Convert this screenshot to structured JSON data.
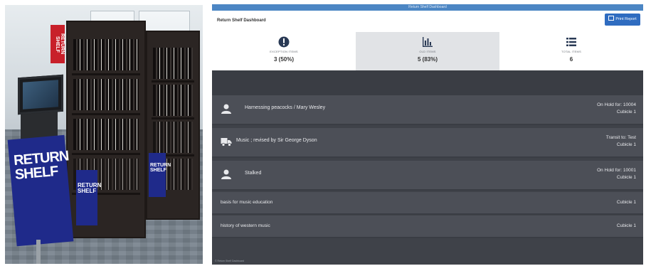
{
  "photo": {
    "sign_large_lines": [
      "RETURN",
      "SHELF"
    ],
    "sign_small_lines": [
      "RETURN",
      "SHELF"
    ],
    "sign_right_lines": [
      "RETURN",
      "SHELF"
    ],
    "sign_top": "RETURN SHELF"
  },
  "app": {
    "window_title": "Return Shelf Dashboard",
    "header_title": "Return Shelf Dashboard",
    "print_button": "Print Report",
    "stats": [
      {
        "label": "EXCEPTION ITEMS",
        "value": "3 (50%)",
        "icon": "exclamation-circle-icon",
        "active": false
      },
      {
        "label": "OLD ITEMS",
        "value": "5 (83%)",
        "icon": "bar-chart-icon",
        "active": true
      },
      {
        "label": "TOTAL ITEMS",
        "value": "6",
        "icon": "list-icon",
        "active": false
      }
    ],
    "rows": [
      {
        "icon": "user-icon",
        "title": "Harnessing peacocks / Mary Wesley",
        "status_line1": "On Hold for: 10004",
        "status_line2": "Cubicle 1"
      },
      {
        "icon": "truck-icon",
        "title": "Music ; revised by Sir George Dyson",
        "status_line1": "Transit to: Test",
        "status_line2": "Cubicle 1"
      },
      {
        "icon": "user-icon",
        "title": "Stalked",
        "status_line1": "On Hold for: 10001",
        "status_line2": "Cubicle 1"
      },
      {
        "icon": "",
        "title": "basis for music education",
        "status_line1": "Cubicle 1",
        "status_line2": ""
      },
      {
        "icon": "",
        "title": "history of western music",
        "status_line1": "Cubicle 1",
        "status_line2": ""
      }
    ],
    "footer": "© Return Shelf Dashboard"
  },
  "colors": {
    "titlebar": "#4c86c4",
    "print_button": "#2f6cc0",
    "row_bg": "#4c4f57",
    "band_bg": "#3a3d44",
    "stat_icon": "#2a3a55",
    "sign_blue": "#1f2a8a",
    "sign_red": "#c8202a"
  }
}
